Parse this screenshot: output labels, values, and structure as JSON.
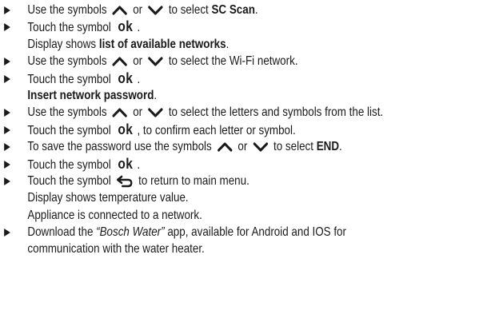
{
  "lines": [
    {
      "type": "bullet",
      "parts": [
        {
          "t": "text",
          "v": "Use the symbols"
        },
        {
          "t": "icon",
          "v": "chevron-up-icon"
        },
        {
          "t": "text",
          "v": "or"
        },
        {
          "t": "icon",
          "v": "chevron-down-icon"
        },
        {
          "t": "text",
          "v": "to select "
        },
        {
          "t": "bold",
          "v": "SC Scan"
        },
        {
          "t": "text",
          "v": "."
        }
      ]
    },
    {
      "type": "bullet",
      "parts": [
        {
          "t": "text",
          "v": "Touch the symbol"
        },
        {
          "t": "ok",
          "v": "ok"
        },
        {
          "t": "text",
          "v": "."
        }
      ]
    },
    {
      "type": "cont",
      "parts": [
        {
          "t": "text",
          "v": "Display shows "
        },
        {
          "t": "bold",
          "v": "list of available networks"
        },
        {
          "t": "text",
          "v": "."
        }
      ]
    },
    {
      "type": "bullet",
      "parts": [
        {
          "t": "text",
          "v": "Use the symbols"
        },
        {
          "t": "icon",
          "v": "chevron-up-icon"
        },
        {
          "t": "text",
          "v": "or"
        },
        {
          "t": "icon",
          "v": "chevron-down-icon"
        },
        {
          "t": "text",
          "v": "to select the Wi-Fi network."
        }
      ]
    },
    {
      "type": "bullet",
      "parts": [
        {
          "t": "text",
          "v": "Touch the symbol"
        },
        {
          "t": "ok",
          "v": "ok"
        },
        {
          "t": "text",
          "v": "."
        }
      ]
    },
    {
      "type": "cont",
      "parts": [
        {
          "t": "bold",
          "v": "Insert network password"
        },
        {
          "t": "text",
          "v": "."
        }
      ]
    },
    {
      "type": "bullet",
      "parts": [
        {
          "t": "text",
          "v": "Use the symbols"
        },
        {
          "t": "icon",
          "v": "chevron-up-icon"
        },
        {
          "t": "text",
          "v": "or"
        },
        {
          "t": "icon",
          "v": "chevron-down-icon"
        },
        {
          "t": "text",
          "v": "to select the letters and symbols from the list."
        }
      ]
    },
    {
      "type": "bullet",
      "parts": [
        {
          "t": "text",
          "v": "Touch the symbol"
        },
        {
          "t": "ok",
          "v": "ok"
        },
        {
          "t": "text",
          "v": ", to confirm each letter or symbol."
        }
      ]
    },
    {
      "type": "bullet",
      "parts": [
        {
          "t": "text",
          "v": "To save the password use the symbols"
        },
        {
          "t": "icon",
          "v": "chevron-up-icon"
        },
        {
          "t": "text",
          "v": "or"
        },
        {
          "t": "icon",
          "v": "chevron-down-icon"
        },
        {
          "t": "text",
          "v": "to select "
        },
        {
          "t": "bold",
          "v": "END"
        },
        {
          "t": "text",
          "v": "."
        }
      ]
    },
    {
      "type": "bullet",
      "parts": [
        {
          "t": "text",
          "v": "Touch the symbol"
        },
        {
          "t": "ok",
          "v": "ok"
        },
        {
          "t": "text",
          "v": "."
        }
      ]
    },
    {
      "type": "bullet",
      "parts": [
        {
          "t": "text",
          "v": "Touch the symbol"
        },
        {
          "t": "icon",
          "v": "return-arrow-icon"
        },
        {
          "t": "text",
          "v": "to return to main menu."
        }
      ]
    },
    {
      "type": "cont",
      "parts": [
        {
          "t": "text",
          "v": "Display shows temperature value."
        }
      ]
    },
    {
      "type": "cont",
      "parts": [
        {
          "t": "text",
          "v": "Appliance is connected to a network."
        }
      ]
    },
    {
      "type": "bullet",
      "parts": [
        {
          "t": "text",
          "v": "Download the "
        },
        {
          "t": "italic",
          "v": "“Bosch Water”"
        },
        {
          "t": "text",
          "v": " app, available for Android and IOS for"
        }
      ]
    },
    {
      "type": "cont",
      "parts": [
        {
          "t": "text",
          "v": "communication with the water heater."
        }
      ]
    }
  ]
}
